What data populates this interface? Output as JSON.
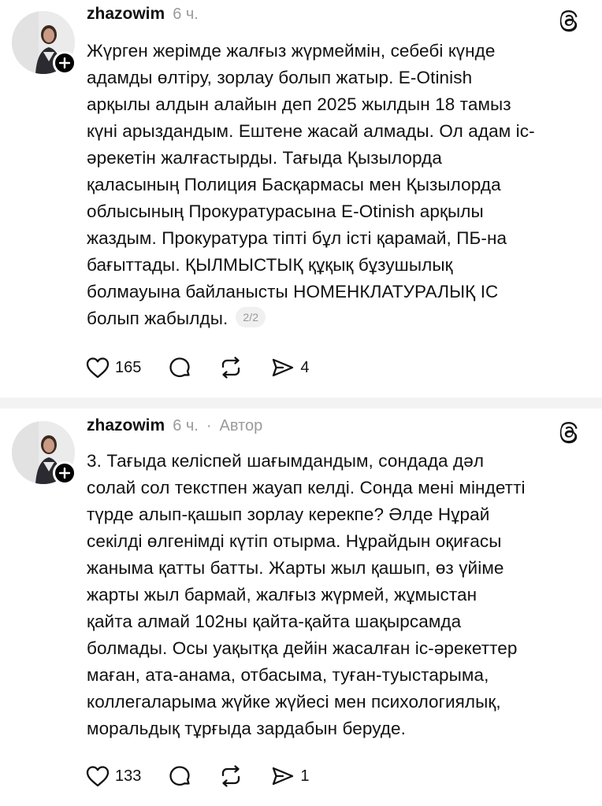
{
  "posts": [
    {
      "username": "zhazowim",
      "time": "6 ч.",
      "role": "",
      "lines": [
        "Жүрген жерімде жалғыз жүрмеймін, себебі күнде",
        "адамды өлтіру, зорлау болып жатыр. E-Otinish",
        "арқылы алдын алайын деп 2025 жылдын 18 тамыз",
        "күні арыздандым. Ештене жасай алмады. Ол адам іс-",
        "әрекетін жалғастырды. Тағыда Қызылорда",
        "қаласының Полиция Басқармасы мен Қызылорда",
        "облысының Прокуратурасына E-Otinish арқылы",
        "жаздым. Прокуратура тіпті бұл істі қарамай, ПБ-на",
        "бағыттады. ҚЫЛМЫСТЫҚ құқық бұзушылық",
        "болмауына байланысты НОМЕНКЛАТУРАЛЫҚ ІС",
        "болып жабылды."
      ],
      "page_badge": "2/2",
      "likes": "165",
      "shares": "4"
    },
    {
      "username": "zhazowim",
      "time": "6 ч.",
      "separator": "·",
      "role": "Автор",
      "lines": [
        "3. Тағыда келіспей шағымдандым, сондада дәл",
        "солай сол текстпен жауап келді. Сонда мені міндетті",
        "түрде алып-қашып зорлау керекпе? Әлде Нұрай",
        "секілді өлгенімді күтіп отырма. Нұрайдын оқиғасы",
        "жаныма қатты батты. Жарты жыл қашып, өз үйіме",
        "жарты жыл бармай, жалғыз жүрмей, жұмыстан",
        "қайта алмай 102ны қайта-қайта шақырсамда",
        "болмады. Осы уақытқа дейін жасалған іс-әрекеттер",
        "маған, ата-анама, отбасыма, туған-туыстарыма,",
        "коллегаларыма жүйке жүйесі мен психологиялық,",
        "моральдық тұрғыда зардабын беруде."
      ],
      "likes": "133",
      "shares": "1"
    }
  ],
  "icons": {
    "like": "heart-icon",
    "comment": "comment-icon",
    "repost": "repost-icon",
    "share": "send-icon",
    "brand": "threads-logo-icon",
    "follow": "plus-icon"
  }
}
